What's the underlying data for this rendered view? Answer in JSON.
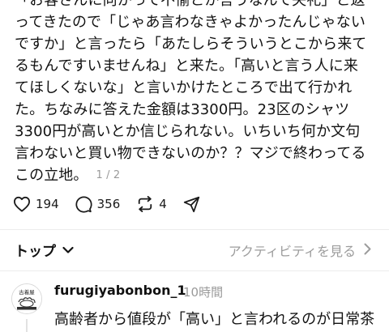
{
  "post": {
    "lines": [
      "「お客さんに向かって不愉とか言うなんて失礼」と返",
      "ってきたので「じゃあ言わなきゃよかったんじゃない",
      "ですか」と言ったら「あたしらそういうとこから来て",
      "るもんですいませんね」と来た。「高いと言う人に来",
      "てほしくないな」と言いかけたところで出て行かれ",
      "た。ちなみに答えた金額は3300円。23区のシャツ",
      "3300円が高いとか信じられない。いちいち何か文句",
      "言わないと買い物できないのか？？マジで終わってる",
      "この立地。"
    ],
    "page_indicator": "1 / 2"
  },
  "actions": {
    "likes": "194",
    "replies": "356",
    "reposts": "4"
  },
  "sort": {
    "label": "トップ",
    "activity_link": "アクティビティを見る"
  },
  "reply": {
    "username": "furugiyabonbon_1",
    "time": "10時間",
    "text": "高齢者から値段が「高い」と言われるのが日常茶",
    "avatar_text": "古着屋"
  },
  "colors": {
    "text": "#121212",
    "muted": "#9a9a9a",
    "divider": "#ececec"
  }
}
